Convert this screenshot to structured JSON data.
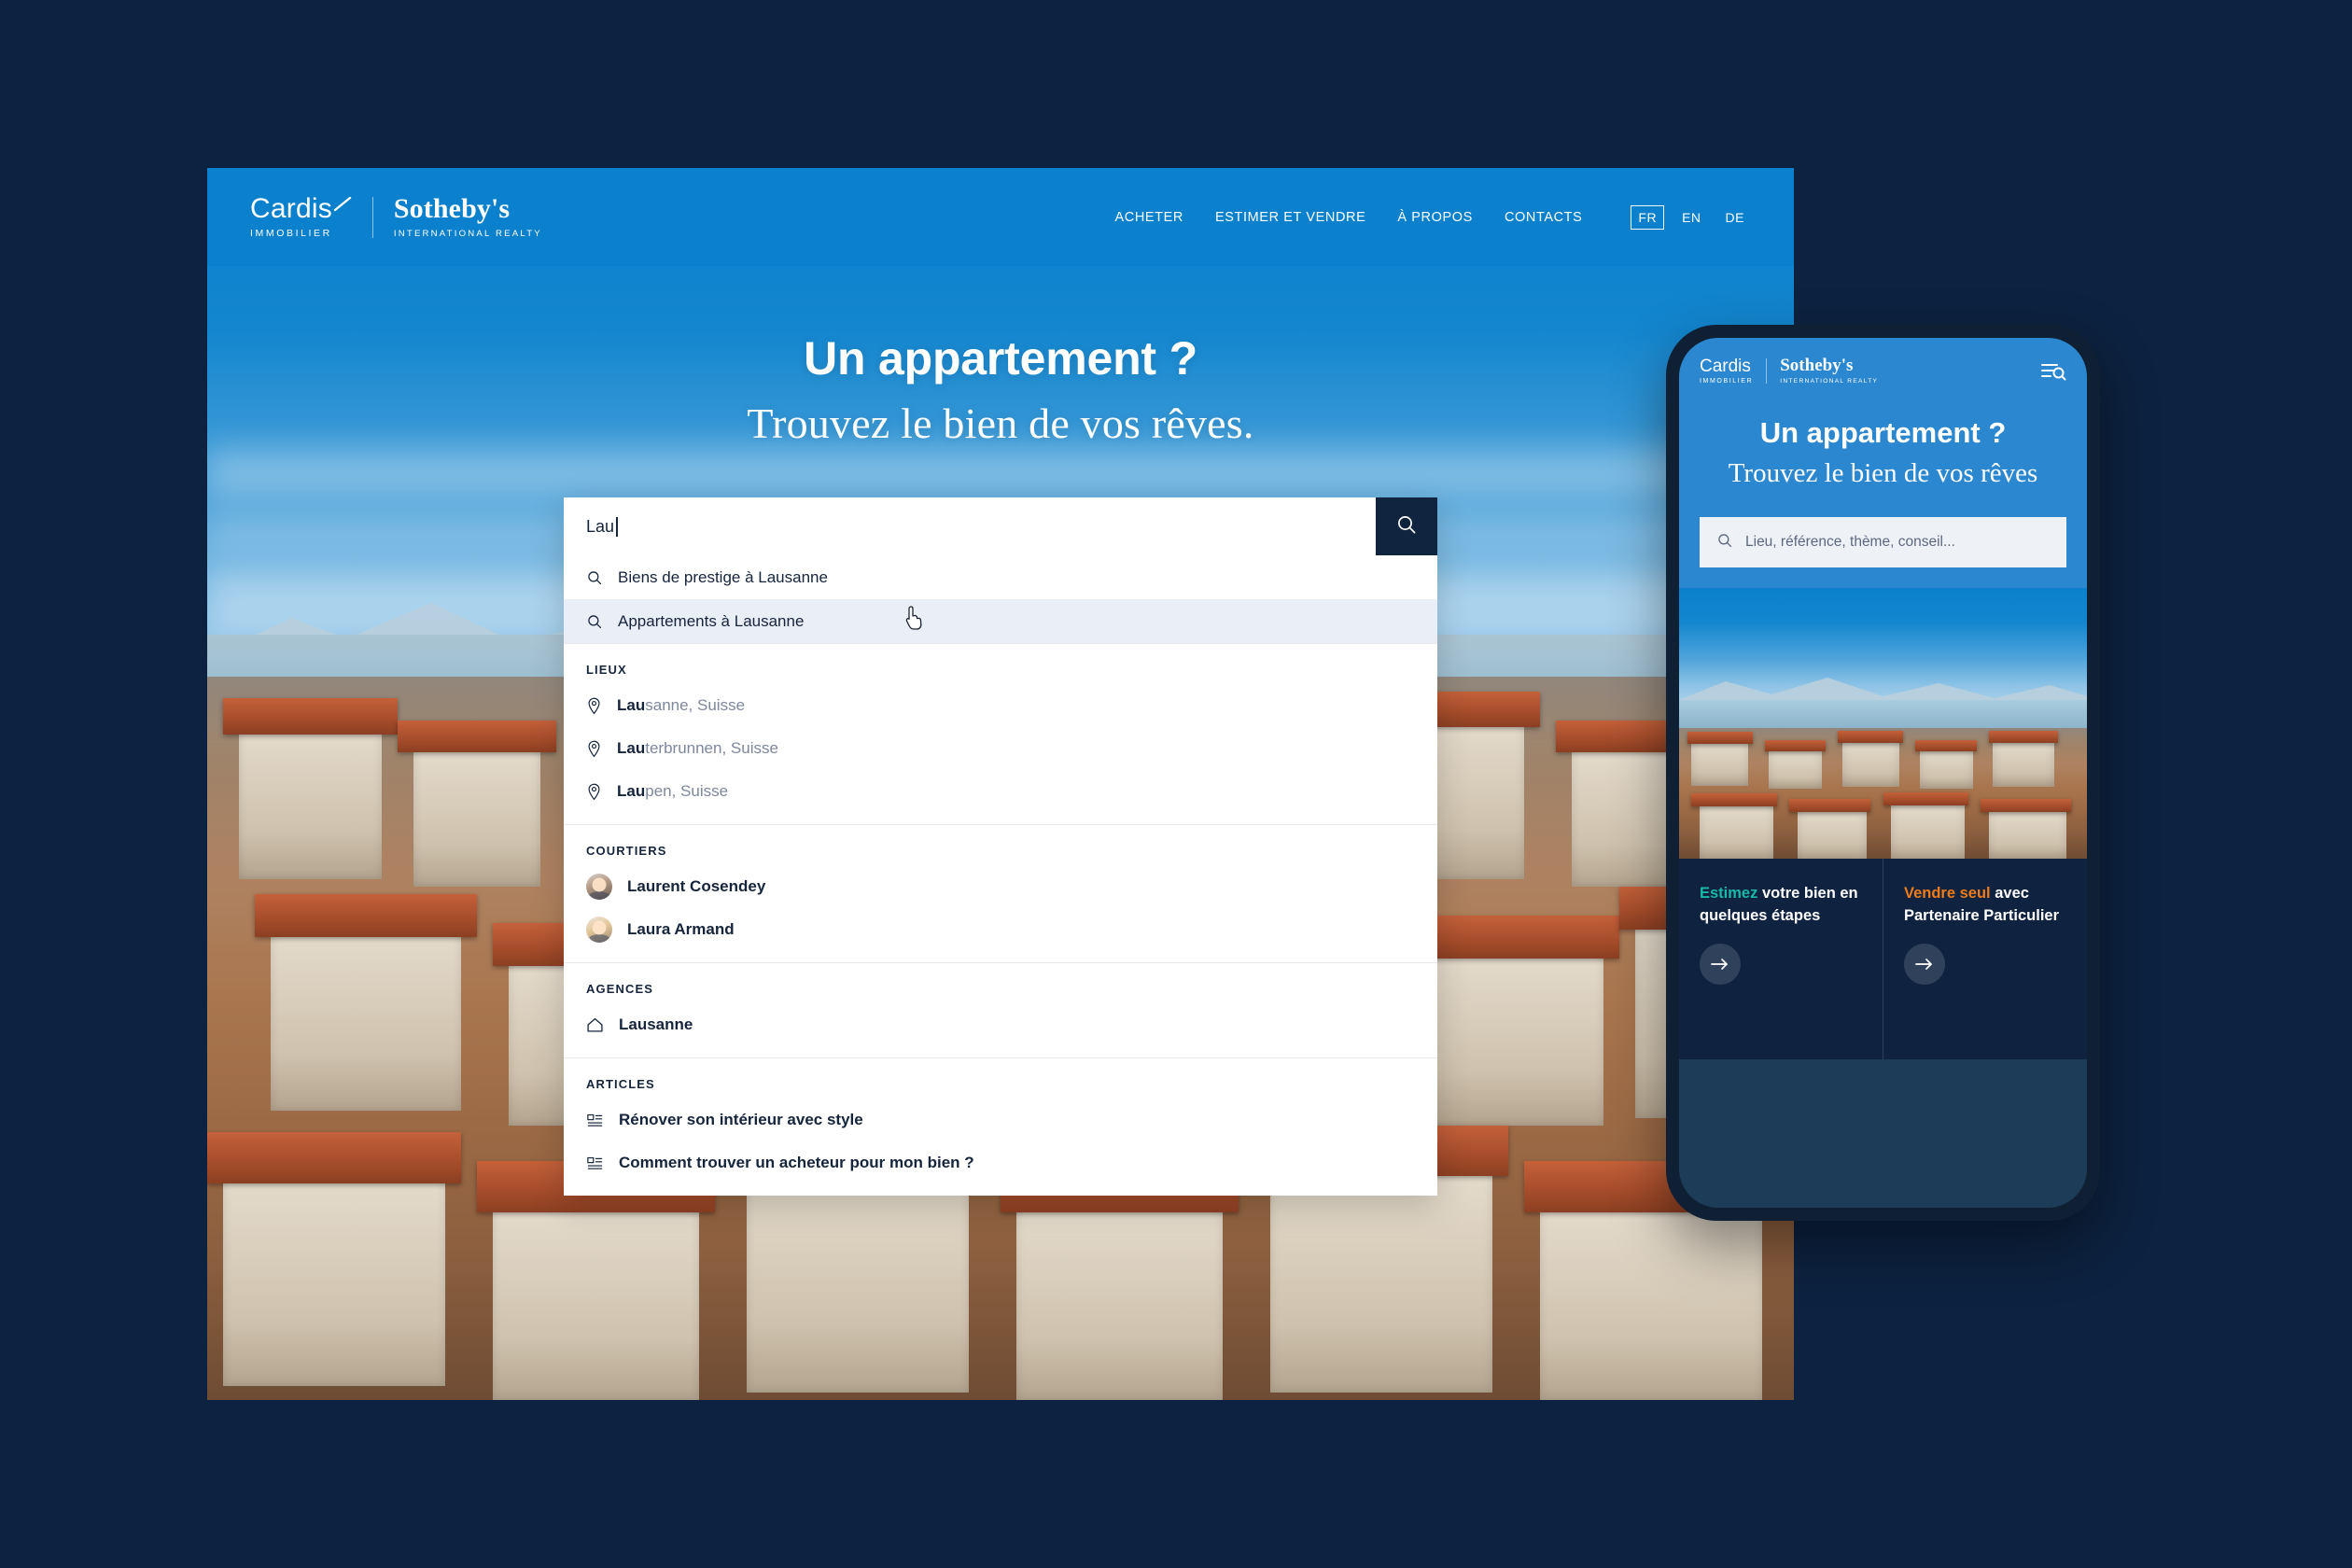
{
  "brand": {
    "cardis_name": "Cardis",
    "cardis_sub": "IMMOBILIER",
    "sothebys_name": "Sotheby's",
    "sothebys_sub": "INTERNATIONAL REALTY"
  },
  "colors": {
    "page_background": "#0d2240",
    "header_blue": "#0b80cc",
    "search_button": "#10233f",
    "suggestion_highlight": "#eaeef7",
    "teal_accent": "#17b8a8",
    "orange_accent": "#ef7c18",
    "card_navy": "#0f2340"
  },
  "desktop": {
    "nav": [
      {
        "label": "ACHETER"
      },
      {
        "label": "ESTIMER ET VENDRE"
      },
      {
        "label": "À PROPOS"
      },
      {
        "label": "CONTACTS"
      }
    ],
    "languages": [
      {
        "code": "FR",
        "active": true
      },
      {
        "code": "EN",
        "active": false
      },
      {
        "code": "DE",
        "active": false
      }
    ],
    "hero": {
      "line1": "Un appartement ?",
      "line2": "Trouvez le bien de vos rêves."
    },
    "search": {
      "value": "Lau",
      "button_icon": "search-icon"
    },
    "suggestions": [
      {
        "label": "Biens de prestige à Lausanne",
        "icon": "search-icon",
        "highlighted": false
      },
      {
        "label": "Appartements à Lausanne",
        "icon": "search-icon",
        "highlighted": true
      }
    ],
    "sections": [
      {
        "label": "LIEUX",
        "icon": "map-pin-icon",
        "items": [
          {
            "prefix": "Lau",
            "rest": "sanne, Suisse"
          },
          {
            "prefix": "Lau",
            "rest": "terbrunnen, Suisse"
          },
          {
            "prefix": "Lau",
            "rest": "pen, Suisse"
          }
        ]
      },
      {
        "label": "COURTIERS",
        "icon": "avatar",
        "items": [
          {
            "prefix": "Laurent Cosendey",
            "rest": ""
          },
          {
            "prefix": "Laura Armand",
            "rest": ""
          }
        ]
      },
      {
        "label": "AGENCES",
        "icon": "home-icon",
        "items": [
          {
            "prefix": "Lausanne",
            "rest": ""
          }
        ]
      },
      {
        "label": "ARTICLES",
        "icon": "article-icon",
        "items": [
          {
            "prefix": "Rénover son intérieur avec style",
            "rest": ""
          },
          {
            "prefix": "Comment trouver un acheteur pour mon bien ?",
            "rest": ""
          }
        ]
      }
    ]
  },
  "mobile": {
    "menu_icon": "menu-search-icon",
    "hero": {
      "line1": "Un appartement ?",
      "line2": "Trouvez le bien de vos rêves"
    },
    "search": {
      "placeholder": "Lieu, référence, thème, conseil...",
      "icon": "search-icon"
    },
    "cards": [
      {
        "accent_text": "Estimez",
        "accent_color": "teal",
        "rest_text": " votre bien en quelques étapes",
        "button_icon": "arrow-right-icon"
      },
      {
        "accent_text": "Vendre seul",
        "accent_color": "orange",
        "rest_text": " avec Partenaire Particulier",
        "button_icon": "arrow-right-icon"
      }
    ]
  }
}
